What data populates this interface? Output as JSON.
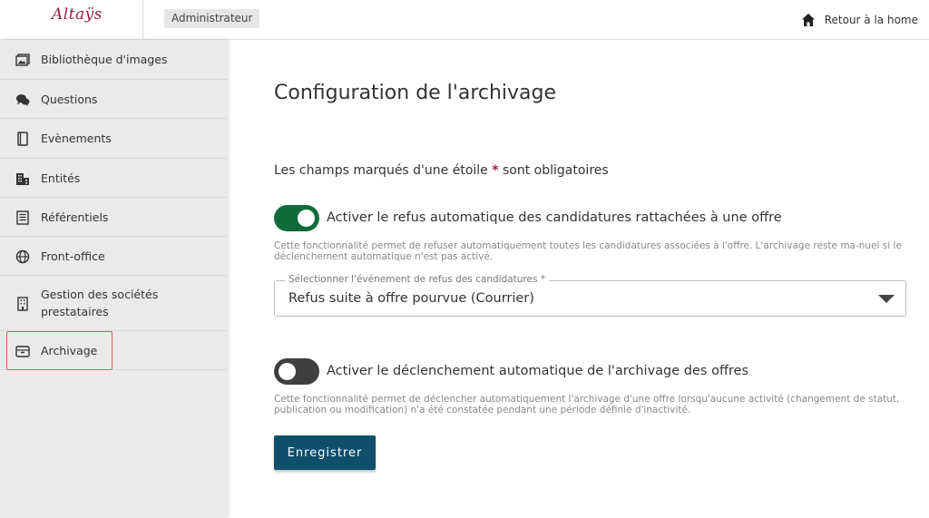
{
  "header": {
    "logo_text": "Altaÿs",
    "role_badge": "Administrateur",
    "home_link": "Retour à la home",
    "home_icon": "home-icon"
  },
  "sidebar": {
    "items": [
      {
        "label": "Bibliothèque d'images",
        "icon": "image-library-icon"
      },
      {
        "label": "Questions",
        "icon": "chat-bubbles-icon"
      },
      {
        "label": "Evènements",
        "icon": "notebook-icon"
      },
      {
        "label": "Entités",
        "icon": "building-icon"
      },
      {
        "label": "Référentiels",
        "icon": "list-icon"
      },
      {
        "label": "Front-office",
        "icon": "globe-icon"
      },
      {
        "label": "Gestion des sociétés prestataires",
        "icon": "office-building-icon"
      },
      {
        "label": "Archivage",
        "icon": "archive-box-icon",
        "active": true
      }
    ]
  },
  "main": {
    "title": "Configuration de l'archivage",
    "required_note_before": "Les champs marqués d'une étoile ",
    "required_star": "*",
    "required_note_after": " sont obligatoires",
    "auto_refusal": {
      "enabled": true,
      "label": "Activer le refus automatique des candidatures rattachées à une offre",
      "help": "Cette fonctionnalité permet de refuser automatiquement toutes les candidatures associées à l'offre. L'archivage reste ma-nuel si le déclenchement automatique n'est pas activé."
    },
    "refusal_event_select": {
      "legend": "Sélectionner l'événement de refus des candidatures *",
      "value": "Refus suite à offre pourvue (Courrier)"
    },
    "auto_archiving": {
      "enabled": false,
      "label": "Activer le déclenchement automatique de l'archivage des offres",
      "help": "Cette fonctionnalité permet de déclencher automatiquement l'archivage d'une offre lorsqu'aucune activité (changement de statut, publication ou modification) n'a été constatée pendant une période définie d'inactivité."
    },
    "save_button": "Enregistrer"
  },
  "colors": {
    "toggle_on": "#0f6b3a",
    "toggle_off": "#3f3f3f",
    "primary_button": "#0f4f6b",
    "required_star": "#b0103a",
    "active_outline": "#e35b5b"
  }
}
